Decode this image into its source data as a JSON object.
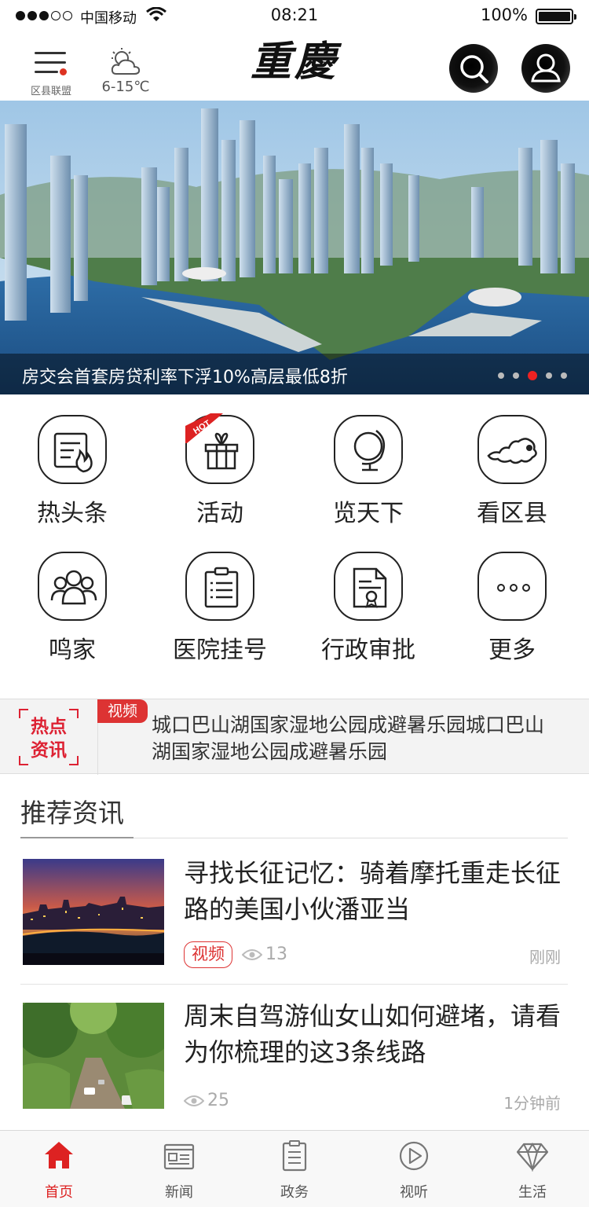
{
  "status_bar": {
    "carrier": "中国移动",
    "time": "08:21",
    "battery": "100%",
    "signal_bars": 3,
    "battery_level": 1.0
  },
  "header": {
    "menu_label": "区县联盟",
    "weather_temp": "6-15℃",
    "logo_text": "重慶"
  },
  "banner": {
    "title": "房交会首套房贷利率下浮10%高层最低8折",
    "pager_count": 5,
    "pager_active": 3
  },
  "grid": {
    "items": [
      {
        "label": "热头条",
        "icon": "headline-fire-icon"
      },
      {
        "label": "活动",
        "icon": "gift-icon",
        "badge": "HOT"
      },
      {
        "label": "览天下",
        "icon": "globe-icon"
      },
      {
        "label": "看区县",
        "icon": "map-icon"
      },
      {
        "label": "鸣家",
        "icon": "people-icon"
      },
      {
        "label": "医院挂号",
        "icon": "clipboard-icon"
      },
      {
        "label": "行政审批",
        "icon": "certificate-icon"
      },
      {
        "label": "更多",
        "icon": "more-icon"
      }
    ]
  },
  "ticker": {
    "badge_line1": "热点",
    "badge_line2": "资讯",
    "tag": "视频",
    "text": "城口巴山湖国家湿地公园成避暑乐园城口巴山湖国家湿地公园成避暑乐园"
  },
  "recommend": {
    "title": "推荐资讯",
    "articles": [
      {
        "title": "寻找长征记忆：骑着摩托重走长征路的美国小伙潘亚当",
        "tag": "视频",
        "views": "13",
        "time": "刚刚"
      },
      {
        "title": "周末自驾游仙女山如何避堵，请看为你梳理的这3条线路",
        "tag": "",
        "views": "25",
        "time": "1分钟前"
      }
    ]
  },
  "tabbar": {
    "tabs": [
      {
        "label": "首页",
        "icon": "home-icon",
        "active": true
      },
      {
        "label": "新闻",
        "icon": "newspaper-icon"
      },
      {
        "label": "政务",
        "icon": "document-icon"
      },
      {
        "label": "视听",
        "icon": "play-icon"
      },
      {
        "label": "生活",
        "icon": "diamond-icon"
      }
    ]
  },
  "colors": {
    "accent": "#dd2222",
    "text": "#222222",
    "muted": "#aaaaaa"
  }
}
